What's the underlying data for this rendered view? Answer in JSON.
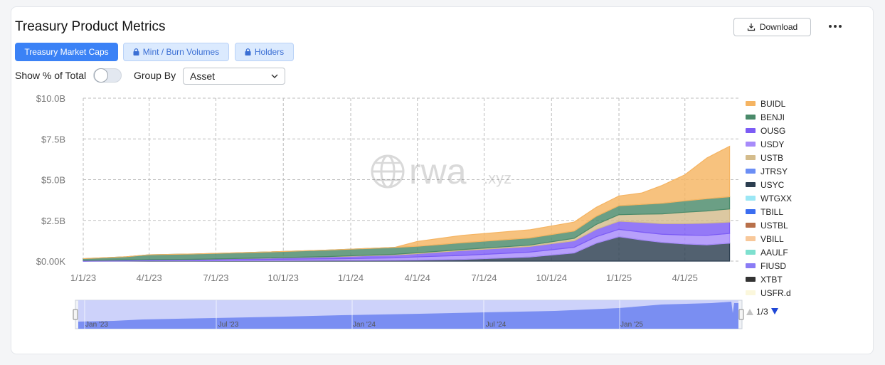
{
  "header": {
    "title": "Treasury Product Metrics",
    "download_label": "Download"
  },
  "tabs": [
    {
      "label": "Treasury Market Caps",
      "active": true
    },
    {
      "label": "Mint / Burn Volumes",
      "locked": true
    },
    {
      "label": "Holders",
      "locked": true
    }
  ],
  "controls": {
    "show_pct_label": "Show % of Total",
    "show_pct_on": false,
    "group_by_label": "Group By",
    "group_by_value": "Asset"
  },
  "watermark": {
    "main": "rwa",
    "suffix": ".xyz"
  },
  "chart_data": {
    "type": "area",
    "stacked": true,
    "y_ticks": [
      "$0.00K",
      "$2.5B",
      "$5.0B",
      "$7.5B",
      "$10.0B"
    ],
    "ylim": [
      0,
      10
    ],
    "x_ticks": [
      "1/1/23",
      "4/1/23",
      "7/1/23",
      "10/1/23",
      "1/1/24",
      "4/1/24",
      "7/1/24",
      "10/1/24",
      "1/1/25",
      "4/1/25"
    ],
    "x": [
      "2023-01",
      "2023-03",
      "2023-04",
      "2023-06",
      "2023-09",
      "2023-12",
      "2024-03",
      "2024-04",
      "2024-06",
      "2024-09",
      "2024-11",
      "2024-12",
      "2025-01",
      "2025-02",
      "2025-03",
      "2025-04",
      "2025-05",
      "2025-06"
    ],
    "series": [
      {
        "name": "USYC",
        "color": "#2c3e50",
        "values": [
          0,
          0.01,
          0.02,
          0.02,
          0.03,
          0.04,
          0.05,
          0.06,
          0.1,
          0.25,
          0.5,
          1.1,
          1.5,
          1.3,
          1.15,
          1.05,
          1.0,
          1.1
        ]
      },
      {
        "name": "USDY",
        "color": "#a78bfa",
        "values": [
          0,
          0.01,
          0.02,
          0.03,
          0.07,
          0.1,
          0.15,
          0.2,
          0.25,
          0.3,
          0.35,
          0.4,
          0.45,
          0.48,
          0.5,
          0.55,
          0.58,
          0.6
        ]
      },
      {
        "name": "OUSG",
        "color": "#7c5cf5",
        "values": [
          0.05,
          0.05,
          0.05,
          0.06,
          0.08,
          0.12,
          0.18,
          0.2,
          0.3,
          0.35,
          0.4,
          0.45,
          0.5,
          0.6,
          0.65,
          0.7,
          0.75,
          0.7
        ]
      },
      {
        "name": "USTB",
        "color": "#d4bc8c",
        "values": [
          0,
          0,
          0,
          0,
          0.01,
          0.02,
          0.04,
          0.05,
          0.06,
          0.08,
          0.15,
          0.3,
          0.4,
          0.5,
          0.6,
          0.7,
          0.75,
          0.8
        ]
      },
      {
        "name": "BENJI",
        "color": "#4a8a6a",
        "values": [
          0.1,
          0.2,
          0.3,
          0.33,
          0.36,
          0.4,
          0.42,
          0.4,
          0.42,
          0.44,
          0.45,
          0.5,
          0.55,
          0.6,
          0.65,
          0.7,
          0.75,
          0.75
        ]
      },
      {
        "name": "BUIDL",
        "color": "#f5b462",
        "values": [
          0,
          0,
          0,
          0,
          0,
          0,
          0,
          0.3,
          0.45,
          0.5,
          0.55,
          0.55,
          0.6,
          0.7,
          1.1,
          1.6,
          2.5,
          3.1
        ]
      }
    ],
    "legend": {
      "position": "right",
      "entries": [
        {
          "name": "BUIDL",
          "color": "#f5b462"
        },
        {
          "name": "BENJI",
          "color": "#4a8a6a"
        },
        {
          "name": "OUSG",
          "color": "#7c5cf5"
        },
        {
          "name": "USDY",
          "color": "#a78bfa"
        },
        {
          "name": "USTB",
          "color": "#d4bc8c"
        },
        {
          "name": "JTRSY",
          "color": "#6b8ef5"
        },
        {
          "name": "USYC",
          "color": "#2c3e50"
        },
        {
          "name": "WTGXX",
          "color": "#9be7f5"
        },
        {
          "name": "TBILL",
          "color": "#3b6df0"
        },
        {
          "name": "USTBL",
          "color": "#b8704a"
        },
        {
          "name": "VBILL",
          "color": "#f8c89a"
        },
        {
          "name": "AAULF",
          "color": "#7ee0cf"
        },
        {
          "name": "FIUSD",
          "color": "#8a7cf5"
        },
        {
          "name": "XTBT",
          "color": "#333333"
        },
        {
          "name": "USFR.d",
          "color": "#fbf7dc"
        }
      ],
      "page": "1/3"
    },
    "navigator_labels": [
      "Jan '23",
      "Jul '23",
      "Jan '24",
      "Jul '24",
      "Jan '25"
    ],
    "grid": true
  }
}
